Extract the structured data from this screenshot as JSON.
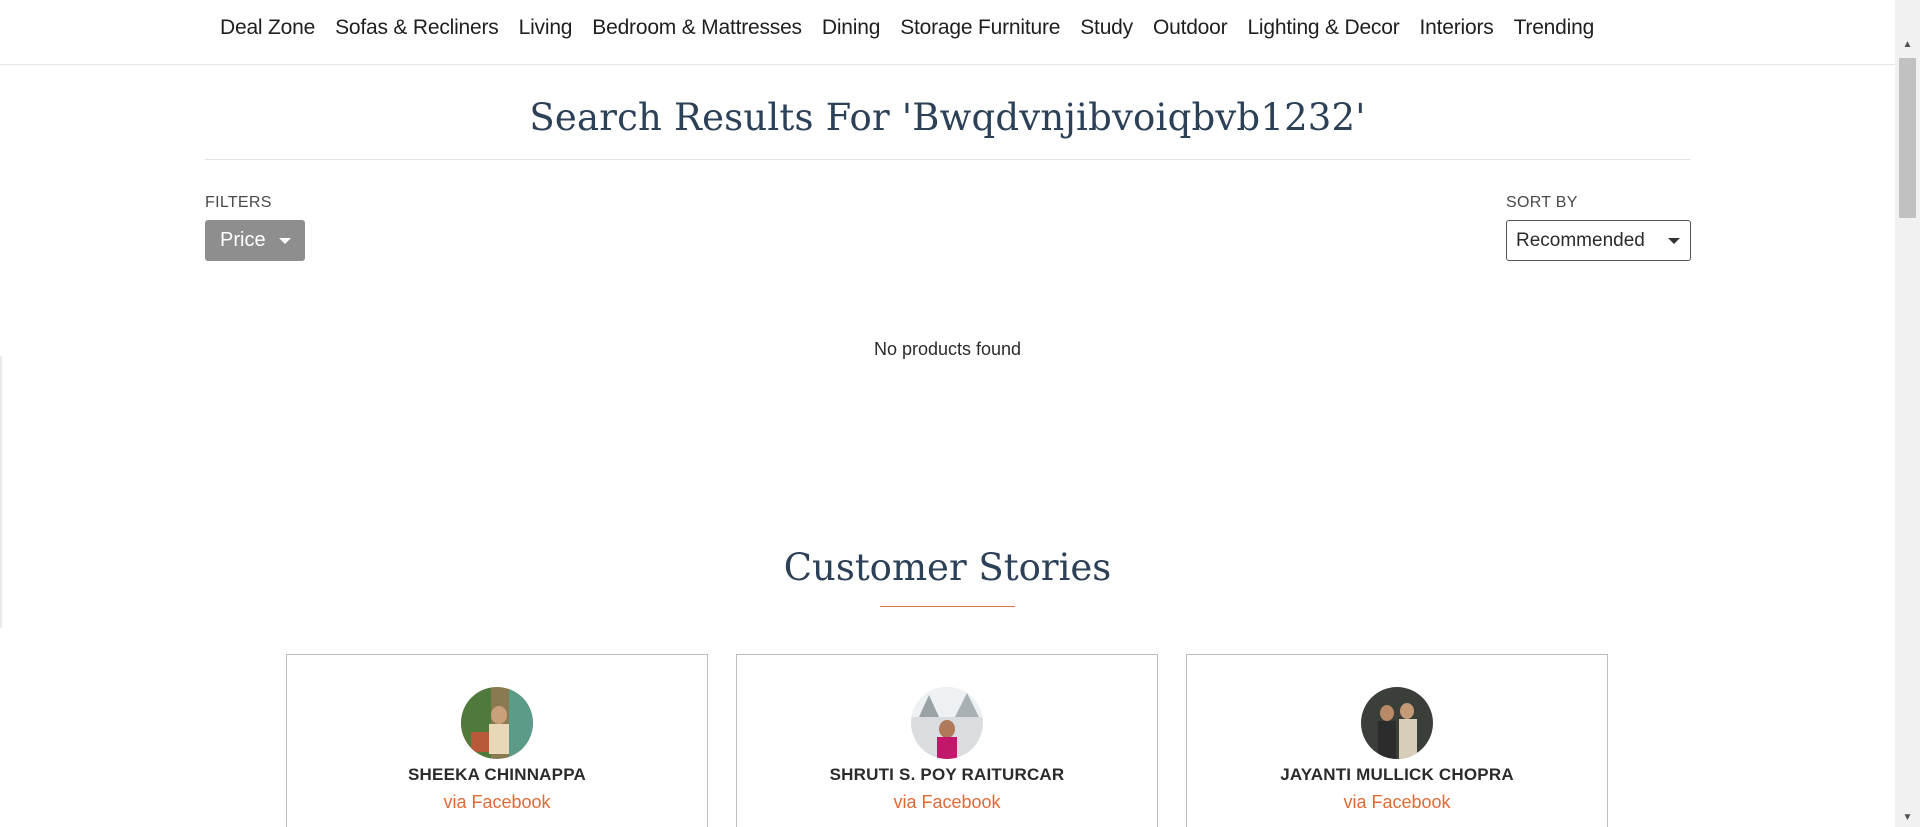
{
  "nav": {
    "items": [
      {
        "label": "Deal Zone"
      },
      {
        "label": "Sofas & Recliners"
      },
      {
        "label": "Living"
      },
      {
        "label": "Bedroom & Mattresses"
      },
      {
        "label": "Dining"
      },
      {
        "label": "Storage Furniture"
      },
      {
        "label": "Study"
      },
      {
        "label": "Outdoor"
      },
      {
        "label": "Lighting & Decor"
      },
      {
        "label": "Interiors"
      },
      {
        "label": "Trending"
      }
    ]
  },
  "search": {
    "title": "Search Results For 'Bwqdvnjibvoiqbvb1232'"
  },
  "filters": {
    "label": "FILTERS",
    "price_label": "Price"
  },
  "sort": {
    "label": "SORT BY",
    "selected": "Recommended"
  },
  "results": {
    "empty_message": "No products found"
  },
  "stories": {
    "title": "Customer Stories",
    "cards": [
      {
        "name": "SHEEKA CHINNAPPA",
        "source": "via Facebook"
      },
      {
        "name": "SHRUTI S. POY RAITURCAR",
        "source": "via Facebook"
      },
      {
        "name": "JAYANTI MULLICK CHOPRA",
        "source": "via Facebook"
      }
    ]
  },
  "colors": {
    "heading": "#2c4057",
    "accent": "#e06a35",
    "filter_button": "#8e8e8e"
  }
}
